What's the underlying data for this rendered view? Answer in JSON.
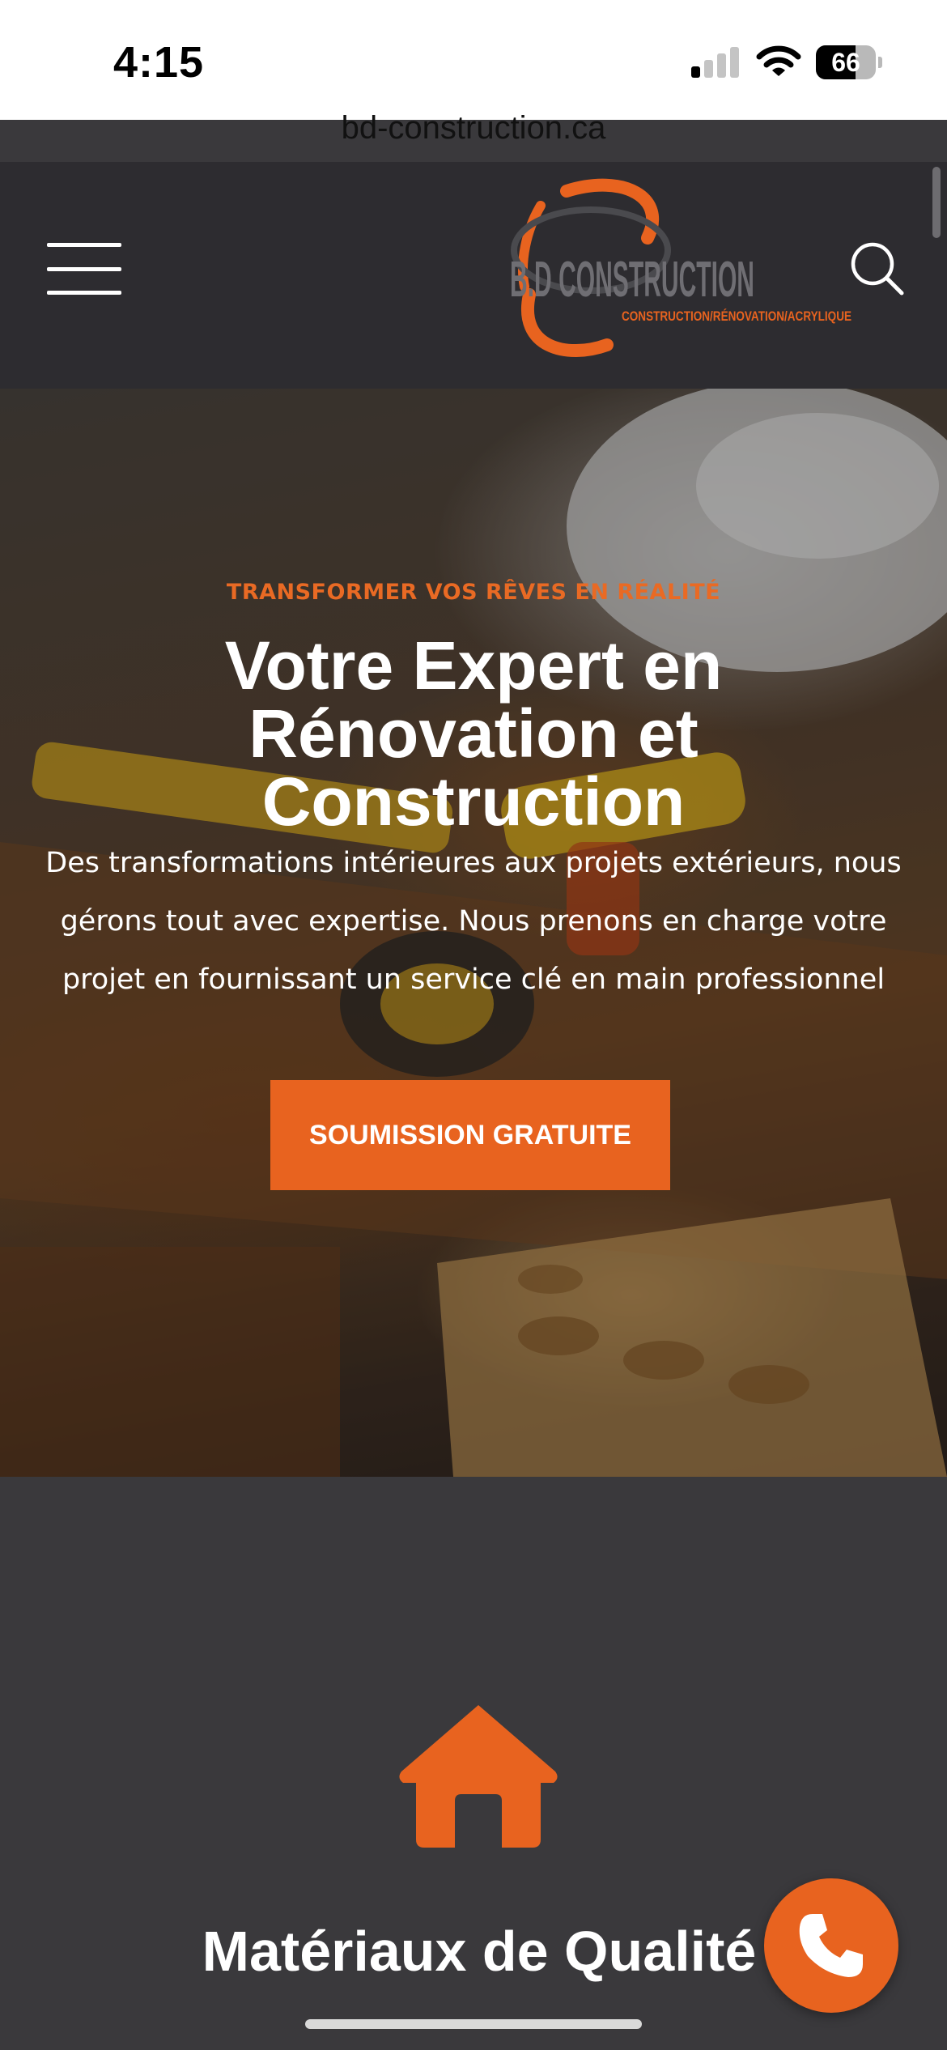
{
  "status_bar": {
    "time": "4:15",
    "battery_level": "66",
    "signal_icon": "cellular-signal-icon",
    "wifi_icon": "wifi-icon",
    "battery_icon": "battery-icon"
  },
  "browser": {
    "url": "bd-construction.ca"
  },
  "header": {
    "menu_icon": "hamburger-menu-icon",
    "search_icon": "search-icon",
    "logo": {
      "name": "B.D CONSTRUCTION",
      "tagline": "CONSTRUCTION/RÉNOVATION/ACRYLIQUE"
    }
  },
  "hero": {
    "kicker": "TRANSFORMER VOS RÊVES EN RÉALITÉ",
    "title": "Votre Expert en Rénovation et Construction",
    "description": "Des transformations intérieures aux projets extérieurs, nous gérons tout avec expertise. Nous prenons en charge votre projet en fournissant un service clé en main professionnel",
    "cta_label": "SOUMISSION GRATUITE"
  },
  "feature": {
    "icon": "house-icon",
    "title": "Matériaux de Qualité"
  },
  "floating": {
    "call_icon": "phone-icon"
  },
  "colors": {
    "accent": "#e8631f",
    "header_bg": "#2d2c30",
    "section_bg": "#3a393c",
    "text_light": "#ffffff"
  }
}
